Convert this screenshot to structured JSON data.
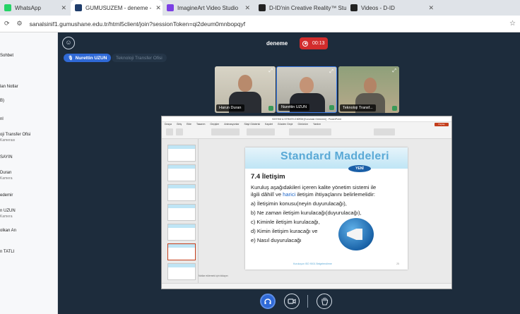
{
  "browser": {
    "tabs": [
      {
        "label": "WhatsApp",
        "fav_color": "#25d366",
        "active": false
      },
      {
        "label": "GUMUSUZEM - deneme -",
        "fav_color": "#1f3d6b",
        "active": true
      },
      {
        "label": "ImagineArt Video Studio",
        "fav_color": "#7b3fe4",
        "active": false
      },
      {
        "label": "D-ID'nin Creative Reality™ Stud",
        "fav_color": "#222222",
        "active": false
      },
      {
        "label": "Videos - D-ID",
        "fav_color": "#222222",
        "active": false
      }
    ],
    "url": "sanalsinif1.gumushane.edu.tr/html5client/join?sessionToken=qi2deum0mnbopqyf"
  },
  "sidebar": {
    "items": [
      {
        "label": "Sohbet",
        "sub": ""
      },
      {
        "label": "lan Notlar",
        "sub": ""
      },
      {
        "label": "B)",
        "sub": ""
      },
      {
        "label": "nl",
        "sub": ""
      },
      {
        "label": "oji Transfer Ofisi",
        "sub": "Kamerası"
      },
      {
        "label": "SAYIN",
        "sub": ""
      },
      {
        "label": "Duran",
        "sub": "Kamera"
      },
      {
        "label": "edemir",
        "sub": ""
      },
      {
        "label": "n UZUN",
        "sub": "Kamera"
      },
      {
        "label": "olkan An",
        "sub": ""
      },
      {
        "label": "n TATLI",
        "sub": ""
      }
    ]
  },
  "meeting": {
    "title": "deneme",
    "timer": "00:13",
    "talkers": {
      "active": "Nurettin UZUN",
      "idle": "Teknoloji Transfer Ofisi"
    },
    "videos": [
      {
        "name": "Harun Duran",
        "active": false
      },
      {
        "name": "Nurettin UZUN",
        "active": true
      },
      {
        "name": "Teknoloji Transf...",
        "active": false
      }
    ]
  },
  "presentation": {
    "window_title": "SİSTEM & STRATEJİ BİRİM [Korumalı Görünüm] - PowerPoint",
    "menu": [
      "Dosya",
      "Giriş",
      "Ekle",
      "Tasarım",
      "Geçişler",
      "Animasyonlar",
      "Slayt Gösterisi",
      "Kaydet",
      "Gözden Geçir",
      "Görünüm",
      "Yardım"
    ],
    "share_label": "Paylaş",
    "slide": {
      "title": "Standard Maddeleri",
      "badge": "YENİ",
      "heading": "7.4 İletişim",
      "lines": [
        {
          "pre": "Kuruluş aşağıdakileri içeren kalite yönetim sistemi ile",
          "hl": "",
          "post": ""
        },
        {
          "pre": "ilgili dâhilî ve ",
          "hl": "harici",
          "post": " iletişim ihtiyaçlarını belirlemelidir:"
        },
        {
          "pre": "a) İletişimin konusu(neyin duyurulacağı),",
          "hl": "",
          "post": ""
        },
        {
          "pre": "b) Ne zaman iletişim kurulacağı(duyurulacağı),",
          "hl": "",
          "post": ""
        },
        {
          "pre": "c) Kiminle iletişim kurulacağı,",
          "hl": "",
          "post": ""
        },
        {
          "pre": "d) Kimin iletişim kuracağı ve",
          "hl": "",
          "post": ""
        },
        {
          "pre": "e) Nasıl duyurulacağı",
          "hl": "",
          "post": ""
        }
      ],
      "footer": "Kuruluşun ISO 9001 Belgelendirme",
      "page": "25"
    },
    "notes_placeholder": "Notlar eklemek için tıklayın"
  }
}
